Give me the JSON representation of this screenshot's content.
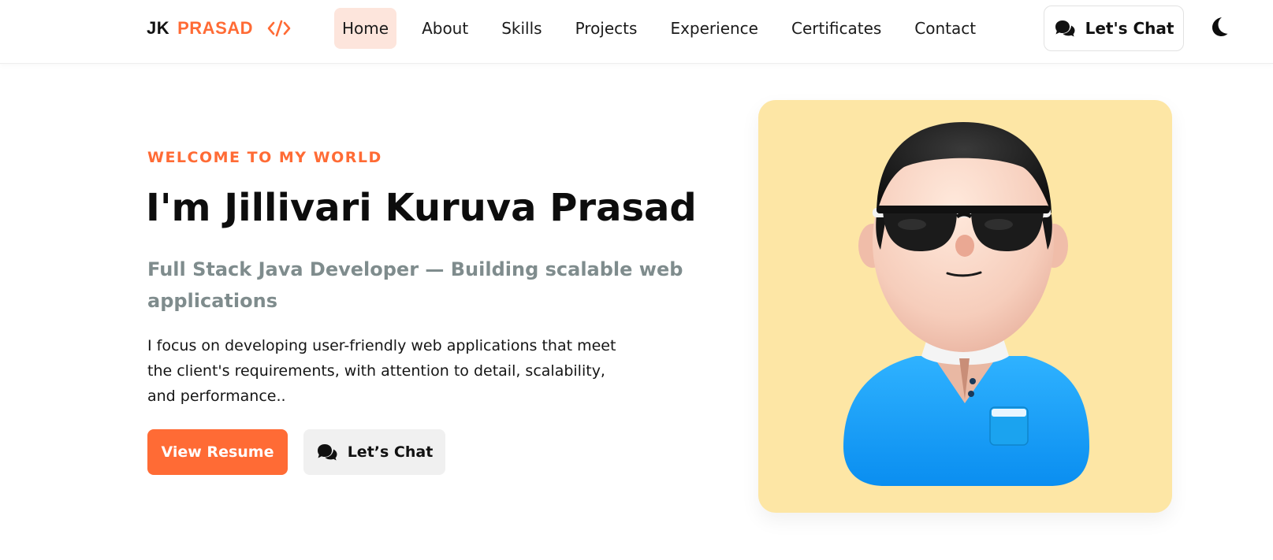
{
  "brand": {
    "first": "JK",
    "second": "PRASAD",
    "icon": "code-icon",
    "accent_color": "#ff6b35"
  },
  "nav": {
    "items": [
      {
        "label": "Home",
        "active": true
      },
      {
        "label": "About",
        "active": false
      },
      {
        "label": "Skills",
        "active": false
      },
      {
        "label": "Projects",
        "active": false
      },
      {
        "label": "Experience",
        "active": false
      },
      {
        "label": "Certificates",
        "active": false
      },
      {
        "label": "Contact",
        "active": false
      }
    ],
    "chat_button": {
      "label": "Let's Chat",
      "icon": "chat-bubbles-icon"
    },
    "theme_toggle": {
      "icon": "moon-icon"
    }
  },
  "hero": {
    "eyebrow": "WELCOME TO MY WORLD",
    "title": "I'm Jillivari Kuruva Prasad",
    "subtitle": "Full Stack Java Developer — Building scalable web applications",
    "description": "I focus on developing user-friendly web applications that meet the client's requirements, with attention to detail, scalability, and performance..",
    "resume_button": "View Resume",
    "chat_button": "Let’s Chat",
    "chat_icon": "chat-bubbles-icon"
  },
  "avatar": {
    "icon": "avatar-illustration",
    "background_color": "#fde6a5"
  },
  "colors": {
    "accent": "#ff6b35",
    "nav_active_bg": "#fde5dc",
    "subtitle": "#7f8c8d"
  }
}
